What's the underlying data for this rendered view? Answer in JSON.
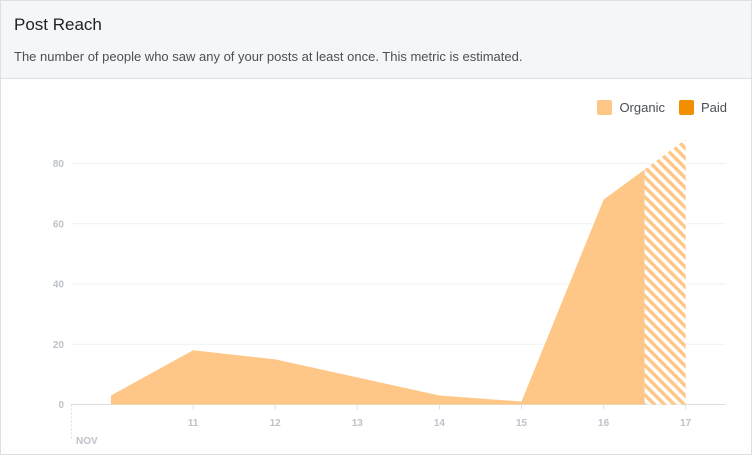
{
  "header": {
    "title": "Post Reach",
    "description": "The number of people who saw any of your posts at least once. This metric is estimated."
  },
  "legend": [
    {
      "label": "Organic",
      "color": "#ffc787"
    },
    {
      "label": "Paid",
      "color": "#f28f00"
    }
  ],
  "chart_data": {
    "type": "area",
    "title": "Post Reach",
    "x_labels": [
      "11",
      "12",
      "13",
      "14",
      "15",
      "16",
      "17"
    ],
    "x_month_label": "NOV",
    "x": [
      "10",
      "11",
      "12",
      "13",
      "14",
      "15",
      "16",
      "17"
    ],
    "series": [
      {
        "name": "Organic",
        "values": [
          3,
          18,
          15,
          9,
          3,
          1,
          68,
          88
        ],
        "color": "#ffc787",
        "estimated_last": true
      },
      {
        "name": "Paid",
        "values": [
          0,
          0,
          0,
          0,
          0,
          0,
          0,
          0
        ],
        "color": "#f28f00"
      }
    ],
    "ylim": [
      0,
      80
    ],
    "yticks": [
      0,
      20,
      40,
      60,
      80
    ],
    "grid": true,
    "legend_position": "top-right"
  }
}
